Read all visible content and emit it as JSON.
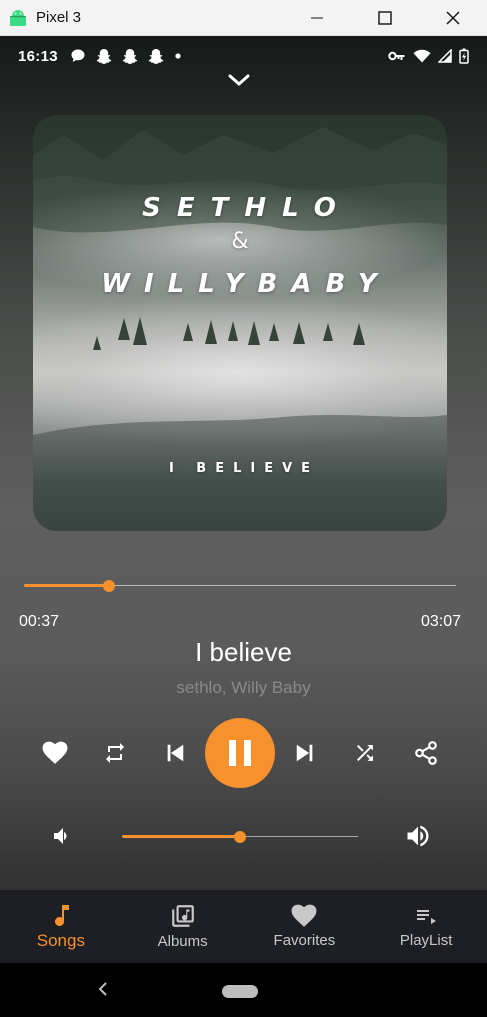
{
  "window": {
    "title": "Pixel 3"
  },
  "status_bar": {
    "time": "16:13"
  },
  "album_art": {
    "line1": "SETHLO",
    "ampersand": "&",
    "line2": "WILLYBABY",
    "line3": "I BELIEVE"
  },
  "player": {
    "current_time": "00:37",
    "total_time": "03:07",
    "progress_fraction": 0.197,
    "title": "I believe",
    "artist": "sethlo, Willy Baby",
    "volume_fraction": 0.5,
    "state": "playing"
  },
  "controls": [
    "heart-icon",
    "repeat-icon",
    "skip-previous-icon",
    "pause-icon",
    "skip-next-icon",
    "shuffle-icon",
    "share-icon"
  ],
  "bottom_nav": {
    "items": [
      {
        "label": "Songs",
        "icon": "music-note-icon",
        "active": true
      },
      {
        "label": "Albums",
        "icon": "album-icon",
        "active": false
      },
      {
        "label": "Favorites",
        "icon": "heart-icon",
        "active": false
      },
      {
        "label": "PlayList",
        "icon": "playlist-icon",
        "active": false
      }
    ]
  },
  "colors": {
    "accent": "#f7912d",
    "nav_bg": "#1d1f24"
  }
}
